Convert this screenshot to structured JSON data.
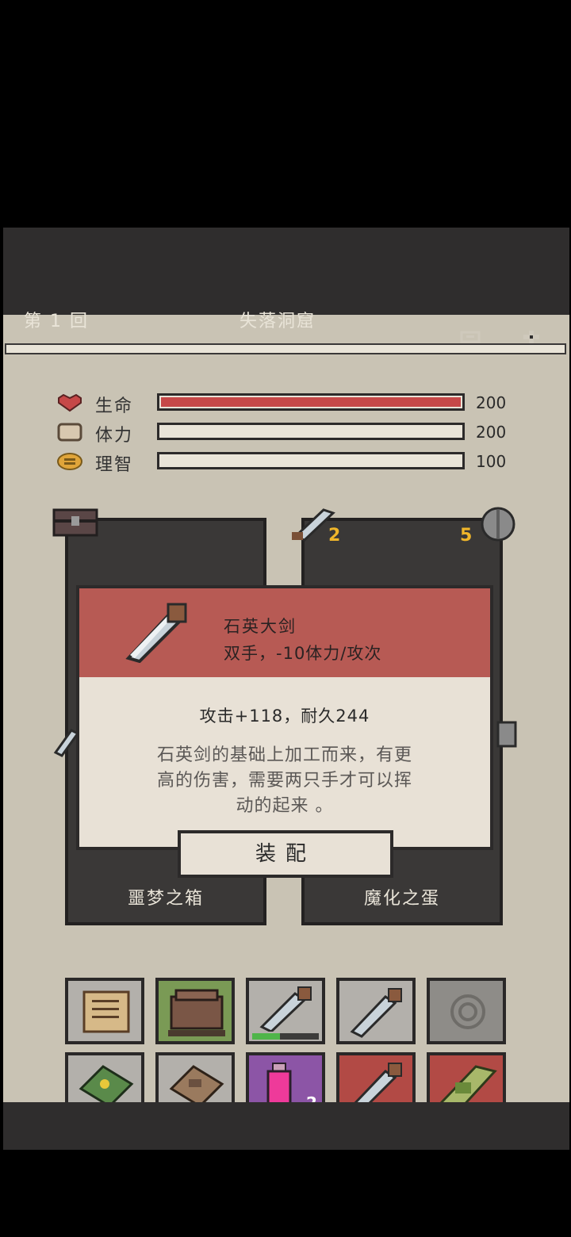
{
  "header": {
    "round_label": "第 1 回",
    "location": "失落洞窟"
  },
  "stats": [
    {
      "label": "生命",
      "value": "200",
      "fill": 1.0,
      "color": "#c64848",
      "icon": "heart-icon"
    },
    {
      "label": "体力",
      "value": "200",
      "fill": 1.0,
      "color": "#e9e4d8",
      "icon": "stamina-icon"
    },
    {
      "label": "理智",
      "value": "100",
      "fill": 1.0,
      "color": "#e9e4d8",
      "icon": "sanity-icon"
    }
  ],
  "cards": {
    "left": {
      "name": "噩梦之箱",
      "icon": "chest-icon"
    },
    "right": {
      "name": "魔化之蛋",
      "icon": "sword-icon",
      "attack": "2",
      "defense": "5"
    }
  },
  "dialog": {
    "item_name": "石英大剑",
    "item_sub": "双手，-10体力/攻次",
    "stat_line": "攻击+118，耐久244",
    "desc_lines": [
      "石英剑的基础上加工而来，有更",
      "高的伤害，需要两只手才可以挥",
      "动的起来 。"
    ],
    "equip_label": "装配"
  },
  "inventory": {
    "row1": [
      {
        "icon": "scroll-icon",
        "bg": "gray"
      },
      {
        "icon": "backpack-icon",
        "bg": "green"
      },
      {
        "icon": "quartz-sword-icon",
        "bg": "gray",
        "durability": 0.42
      },
      {
        "icon": "quartz-sword-icon",
        "bg": "gray"
      },
      {
        "icon": "empty-slot-icon",
        "bg": "gray"
      }
    ],
    "row2": [
      {
        "icon": "green-book-icon",
        "bg": "gray"
      },
      {
        "icon": "brown-book-icon",
        "bg": "gray"
      },
      {
        "icon": "potion-icon",
        "bg": "purple",
        "count": "2"
      },
      {
        "icon": "quartz-sword-icon",
        "bg": "red"
      },
      {
        "icon": "herb-icon",
        "bg": "red"
      }
    ]
  },
  "colors": {
    "accent_red": "#b75a54",
    "panel": "#3a3837",
    "bg": "#c9c3b4"
  }
}
